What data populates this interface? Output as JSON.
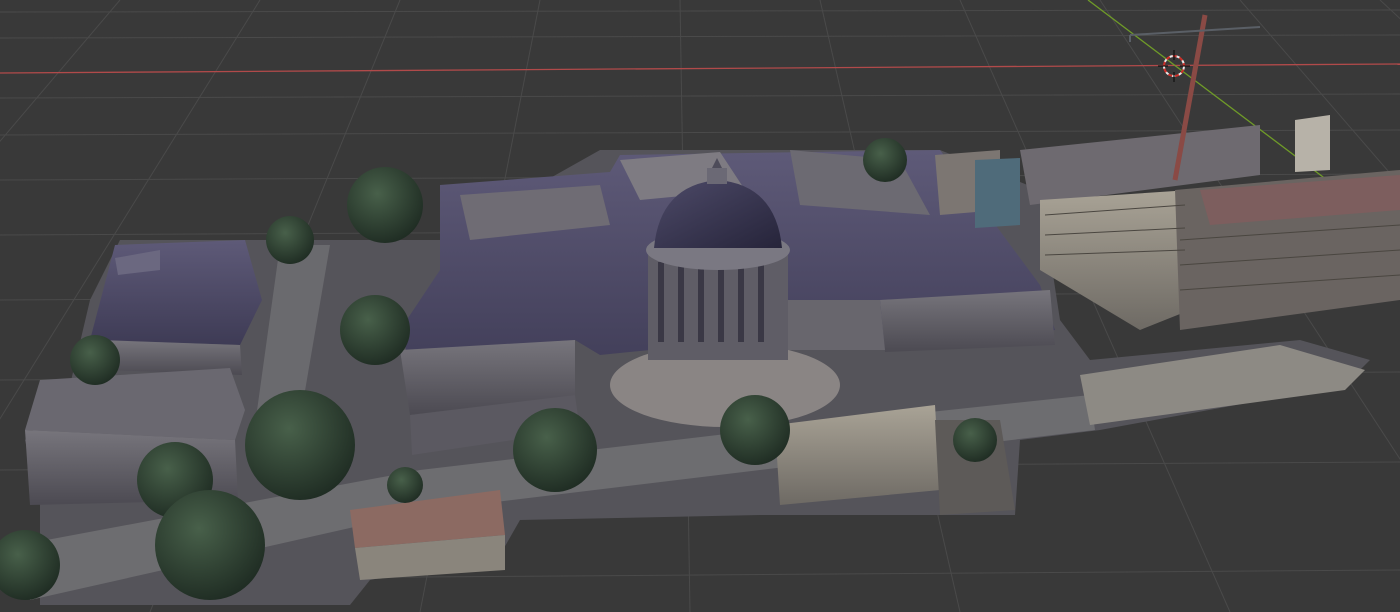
{
  "viewport": {
    "background": "#393939",
    "grid_color": "#4a4a4a",
    "x_axis_color": "#b14a4a",
    "y_axis_color": "#6f9b28"
  },
  "scene": {
    "object": "photogrammetry-campus-mesh",
    "features": [
      "domed-main-building",
      "courtyard-wings",
      "trees",
      "street",
      "office-blocks",
      "crane"
    ]
  },
  "overlays": {
    "cursor_icon": "3d-cursor-icon"
  }
}
